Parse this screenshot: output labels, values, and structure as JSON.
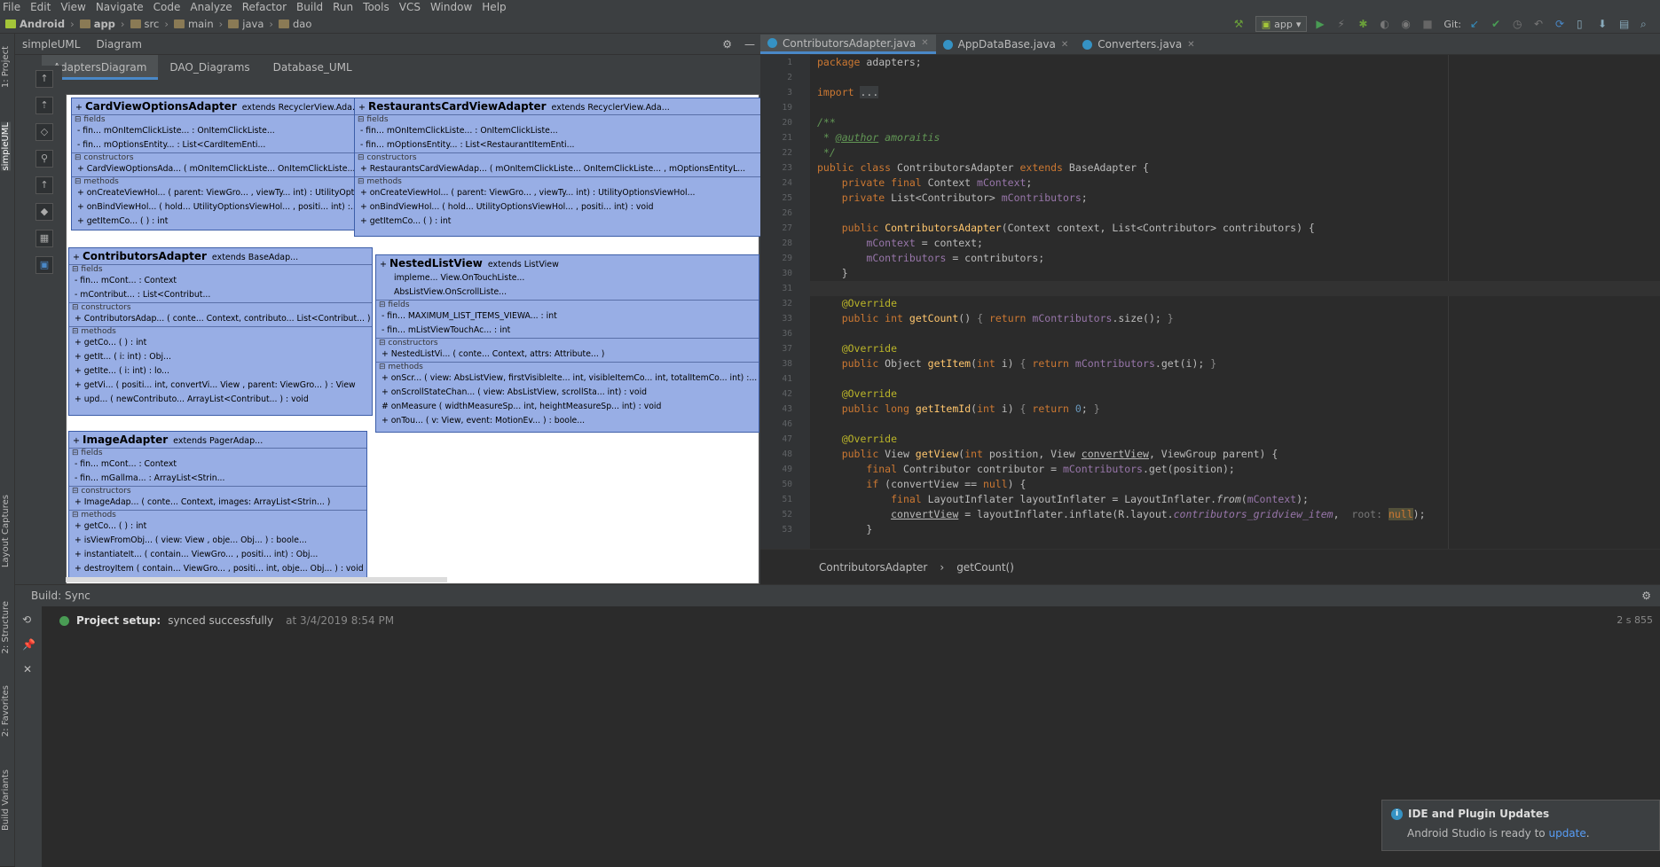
{
  "menu": [
    "File",
    "Edit",
    "View",
    "Navigate",
    "Code",
    "Analyze",
    "Refactor",
    "Build",
    "Run",
    "Tools",
    "VCS",
    "Window",
    "Help"
  ],
  "breadcrumbs": [
    "Android",
    "app",
    "src",
    "main",
    "java",
    "dao"
  ],
  "run_config": "app",
  "git_label": "Git:",
  "left_tabs": [
    "1: Project",
    "simpleUML",
    "Layout Captures",
    "2: Structure",
    "2: Favorites",
    "Build Variants"
  ],
  "uml": {
    "panel_tabs": [
      "simpleUML",
      "Diagram"
    ],
    "diagram_tabs": [
      "AdaptersDiagram",
      "DAO_Diagrams",
      "Database_UML"
    ],
    "classes": [
      {
        "name": "CardViewOptionsAdapter",
        "ext": "extends  RecyclerView.Ada...",
        "rows": [
          {
            "sec": "fields"
          },
          {
            "r": "- fin...     mOnItemClickListe...       : OnItemClickListe..."
          },
          {
            "r": "- fin...     mOptionsEntity...      : List<CardItemEnti..."
          },
          {
            "sec": "constructors"
          },
          {
            "r": "+   CardViewOptionsAda...  ( mOnItemClickListe...     OnItemClickListe..."
          },
          {
            "sec": "methods"
          },
          {
            "r": "+   onCreateViewHol...   ( parent: ViewGro... , viewTy...    int) : UtilityOpti..."
          },
          {
            "r": "+   onBindViewHol...   ( hold...   UtilityOptionsViewHol...   , positi...    int) :..."
          },
          {
            "r": "+   getItemCo...   ( ) : int"
          }
        ]
      },
      {
        "name": "RestaurantsCardViewAdapter",
        "ext": "extends  RecyclerView.Ada...",
        "rows": [
          {
            "sec": "fields"
          },
          {
            "r": "- fin...     mOnItemClickListe...       : OnItemClickListe..."
          },
          {
            "r": "- fin...     mOptionsEntity...      : List<RestaurantItemEnti..."
          },
          {
            "sec": "constructors"
          },
          {
            "r": "+   RestaurantsCardViewAdap...   ( mOnItemClickListe...     OnItemClickListe...     , mOptionsEntityL..."
          },
          {
            "sec": "methods"
          },
          {
            "r": "+   onCreateViewHol...   ( parent: ViewGro... , viewTy...    int) : UtilityOptionsViewHol..."
          },
          {
            "r": "+   onBindViewHol...   ( hold...   UtilityOptionsViewHol...   , positi...    int) : void"
          },
          {
            "r": "+   getItemCo...   ( ) : int"
          }
        ]
      },
      {
        "name": "ContributorsAdapter",
        "ext": "extends  BaseAdap...",
        "rows": [
          {
            "sec": "fields"
          },
          {
            "r": "- fin...     mCont...     : Context"
          },
          {
            "r": "-     mContribut...     : List<Contribut..."
          },
          {
            "sec": "constructors"
          },
          {
            "r": "+   ContributorsAdap...   ( conte...   Context,  contributo...    List<Contribut...  )"
          },
          {
            "sec": "methods"
          },
          {
            "r": "+   getCo...   ( ) : int"
          },
          {
            "r": "+   getIt...   ( i: int) : Obj..."
          },
          {
            "r": "+   getIte...   ( i: int) : lo..."
          },
          {
            "r": "+   getVi...   ( positi...    int,  convertVi...    View ,  parent: ViewGro... ) : View"
          },
          {
            "r": "+   upd...   ( newContributo...   ArrayList<Contribut...   ) : void"
          }
        ]
      },
      {
        "name": "NestedListView",
        "ext": "extends  ListView",
        "impl": [
          "impleme...       View.OnTouchListe...",
          "                     AbsListView.OnScrollListe..."
        ],
        "rows": [
          {
            "sec": "fields"
          },
          {
            "r": "- fin...     MAXIMUM_LIST_ITEMS_VIEWA...     : int"
          },
          {
            "r": "- fin...     mListViewTouchAc...      : int"
          },
          {
            "sec": "constructors"
          },
          {
            "r": "+   NestedListVi...   ( conte...   Context,  attrs: Attribute...   )"
          },
          {
            "sec": "methods"
          },
          {
            "r": "+   onScr...   ( view: AbsListView,  firstVisibleIte...   int,  visibleItemCo...    int,  totalItemCo...    int) :..."
          },
          {
            "r": "+   onScrollStateChan...     ( view: AbsListView,  scrollSta...   int) : void"
          },
          {
            "r": "#   onMeasure ( widthMeasureSp...    int,  heightMeasureSp...    int) : void"
          },
          {
            "r": "+   onTou...   ( v: View,  event: MotionEv...   ) : boole..."
          }
        ]
      },
      {
        "name": "ImageAdapter",
        "ext": "extends  PagerAdap...",
        "rows": [
          {
            "sec": "fields"
          },
          {
            "r": "- fin...     mCont...     : Context"
          },
          {
            "r": "- fin...     mGallma...      : ArrayList<Strin..."
          },
          {
            "sec": "constructors"
          },
          {
            "r": "+   ImageAdap...   ( conte...   Context,  images: ArrayList<Strin...  )"
          },
          {
            "sec": "methods"
          },
          {
            "r": "+   getCo...   ( ) : int"
          },
          {
            "r": "+   isViewFromObj...   ( view: View ,  obje...   Obj... ) : boole..."
          },
          {
            "r": "+   instantiateIt...   ( contain...   ViewGro... ,  positi...    int) : Obj..."
          },
          {
            "r": "+   destroyItem ( contain...   ViewGro... ,  positi...    int,  obje...   Obj... ) : void"
          }
        ]
      }
    ]
  },
  "editor": {
    "tabs": [
      "ContributorsAdapter.java",
      "AppDataBase.java",
      "Converters.java"
    ],
    "lines": [
      {
        "n": "1",
        "h": "<span class='kw'>package</span> adapters;"
      },
      {
        "n": "2",
        "h": ""
      },
      {
        "n": "3",
        "h": "<span class='kw'>import</span> <span style='background:#3a3d3f'>...</span>"
      },
      {
        "n": "19",
        "h": ""
      },
      {
        "n": "20",
        "h": "<span class='cm it'>/**</span>"
      },
      {
        "n": "21",
        "h": "<span class='cm it'> * <span style='text-decoration:underline'>@author</span> amoraitis</span>"
      },
      {
        "n": "22",
        "h": "<span class='cm it'> */</span>"
      },
      {
        "n": "23",
        "h": "<span class='kw'>public class</span> ContributorsAdapter <span class='kw'>extends</span> BaseAdapter {"
      },
      {
        "n": "24",
        "h": "    <span class='kw'>private final</span> Context <span class='fd'>mContext</span>;"
      },
      {
        "n": "25",
        "h": "    <span class='kw'>private</span> List&lt;Contributor&gt; <span class='fd'>mContributors</span>;"
      },
      {
        "n": "26",
        "h": ""
      },
      {
        "n": "27",
        "h": "    <span class='kw'>public</span> <span class='fn'>ContributorsAdapter</span>(Context context, List&lt;Contributor&gt; contributors) {"
      },
      {
        "n": "28",
        "h": "        <span class='fd'>mContext</span> = context;"
      },
      {
        "n": "29",
        "h": "        <span class='fd'>mContributors</span> = contributors;"
      },
      {
        "n": "30",
        "h": "    }"
      },
      {
        "n": "31",
        "h": ""
      },
      {
        "n": "32",
        "h": "    <span class='an'>@Override</span>"
      },
      {
        "n": "33",
        "h": "    <span class='kw'>public int</span> <span class='fn'>getCount</span>() <span style='color:#888'>{</span> <span class='kw'>return</span> <span class='fd'>mContributors</span>.size(); <span style='color:#888'>}</span>"
      },
      {
        "n": "36",
        "h": ""
      },
      {
        "n": "37",
        "h": "    <span class='an'>@Override</span>"
      },
      {
        "n": "38",
        "h": "    <span class='kw'>public</span> Object <span class='fn'>getItem</span>(<span class='kw'>int</span> i) <span style='color:#888'>{</span> <span class='kw'>return</span> <span class='fd'>mContributors</span>.get(i); <span style='color:#888'>}</span>"
      },
      {
        "n": "41",
        "h": ""
      },
      {
        "n": "42",
        "h": "    <span class='an'>@Override</span>"
      },
      {
        "n": "43",
        "h": "    <span class='kw'>public long</span> <span class='fn'>getItemId</span>(<span class='kw'>int</span> i) <span style='color:#888'>{</span> <span class='kw'>return</span> <span style='color:#6897bb'>0</span>; <span style='color:#888'>}</span>"
      },
      {
        "n": "46",
        "h": ""
      },
      {
        "n": "47",
        "h": "    <span class='an'>@Override</span>"
      },
      {
        "n": "48",
        "h": "    <span class='kw'>public</span> View <span class='fn'>getView</span>(<span class='kw'>int</span> position, View <span style='text-decoration:underline'>convertView</span>, ViewGroup parent) {"
      },
      {
        "n": "49",
        "h": "        <span class='kw'>final</span> Contributor contributor = <span class='fd'>mContributors</span>.get(position);"
      },
      {
        "n": "50",
        "h": "        <span class='kw'>if</span> (convertView == <span class='kw'>null</span>) {"
      },
      {
        "n": "51",
        "h": "            <span class='kw'>final</span> LayoutInflater layoutInflater = LayoutInflater.<span class='it'>from</span>(<span class='fd'>mContext</span>);"
      },
      {
        "n": "52",
        "h": "            <span style='text-decoration:underline'>convertView</span> = layoutInflater.inflate(R.layout.<span class='fd it'>contributors_gridview_item</span>,  <span style='color:#787878'>root:</span> <span class='kw' style='background:#52503a'>null</span>);"
      },
      {
        "n": "53",
        "h": "        }"
      }
    ],
    "breadcrumb": [
      "ContributorsAdapter",
      "getCount()"
    ]
  },
  "build": {
    "tab": "Build: Sync",
    "status": "Project setup:",
    "msg": "synced successfully",
    "time": "at 3/4/2019 8:54 PM",
    "duration": "2 s 855"
  },
  "notification": {
    "title": "IDE and Plugin Updates",
    "body": "Android Studio is ready to",
    "link": "update",
    "end": "."
  }
}
